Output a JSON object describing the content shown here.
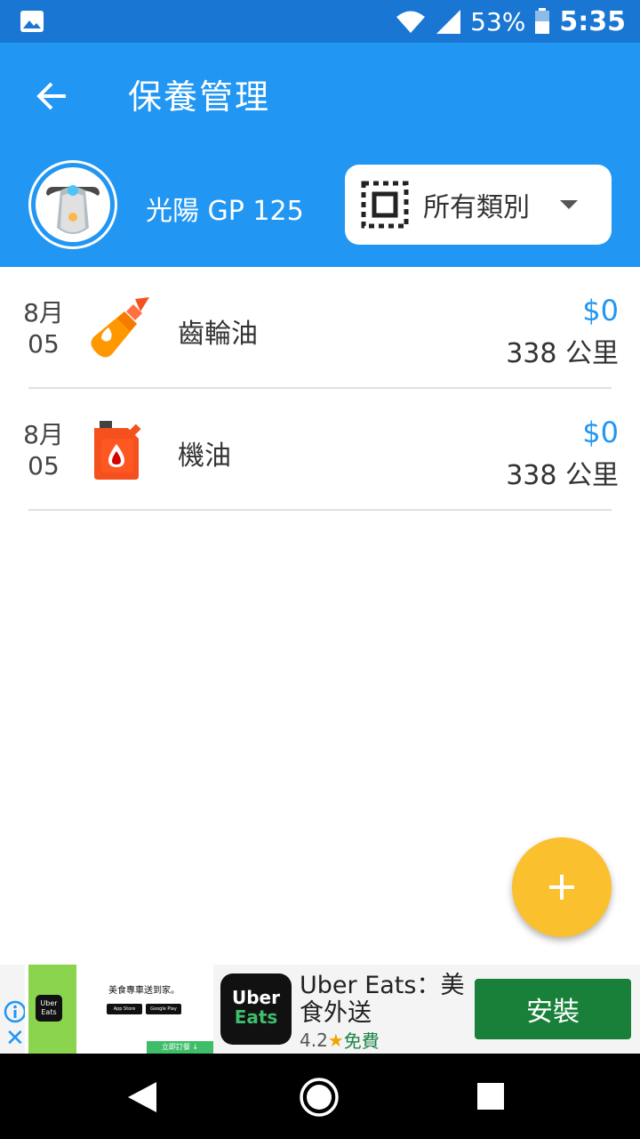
{
  "status_bar": {
    "battery": "53%",
    "time": "5:35",
    "icons": [
      "image-icon",
      "wifi-icon",
      "signal-icon",
      "battery-icon"
    ]
  },
  "header": {
    "title": "保養管理",
    "vehicle_name": "光陽 GP 125",
    "category_label": "所有類別"
  },
  "records": [
    {
      "month": "8月",
      "day": "05",
      "name": "齒輪油",
      "cost": "$0",
      "distance": "338 公里",
      "icon": "gear-oil-icon"
    },
    {
      "month": "8月",
      "day": "05",
      "name": "機油",
      "cost": "$0",
      "distance": "338 公里",
      "icon": "engine-oil-icon"
    }
  ],
  "ad": {
    "banner_slogan": "美食專車送到家。",
    "banner_logo": "Uber Eats",
    "store_badges": [
      "App Store",
      "Google Play"
    ],
    "banner_cta": "立即訂餐 ↓",
    "app_logo_top": "Uber",
    "app_logo_bottom": "Eats",
    "app_name": "Uber Eats：美食外送",
    "rating": "4.2",
    "price": "免費",
    "install_label": "安裝"
  },
  "colors": {
    "status_bar": "#1976d2",
    "app_bar": "#2196f3",
    "accent": "#2196f3",
    "fab": "#fbc02d",
    "install": "#188038"
  }
}
